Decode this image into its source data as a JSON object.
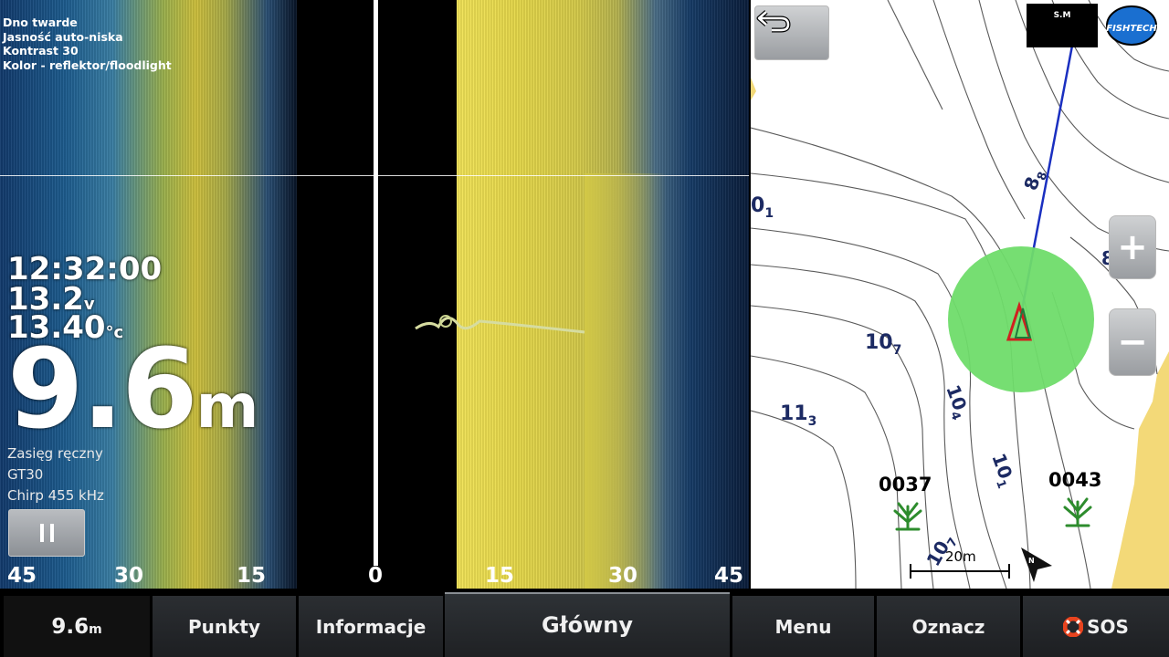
{
  "sonar": {
    "settings": [
      "Dno twarde",
      "Jasność auto-niska",
      "Kontrast 30",
      "Kolor - reflektor/floodlight"
    ],
    "time": "12:32:00",
    "voltage": "13.2",
    "voltage_unit": "v",
    "temperature": "13.40",
    "temperature_unit": "°c",
    "depth": "9.6",
    "depth_unit": "m",
    "range_mode": "Zasięg ręczny",
    "transducer": "GT30",
    "frequency": "Chirp 455 kHz",
    "scale": [
      "45",
      "30",
      "15",
      "0",
      "15",
      "30",
      "45"
    ]
  },
  "map": {
    "depth_labels": [
      {
        "main": "0",
        "sub": "1"
      },
      {
        "main": "8",
        "sub": "8"
      },
      {
        "main": "10",
        "sub": "7"
      },
      {
        "main": "11",
        "sub": "3"
      },
      {
        "main": "10",
        "sub": "4"
      },
      {
        "main": "10",
        "sub": "1"
      },
      {
        "main": "10",
        "sub": "7"
      },
      {
        "main": "8",
        "sub": "8"
      }
    ],
    "waypoint_1": "0037",
    "waypoint_2": "0043",
    "scale_label": "20m",
    "north_label": "N",
    "zoom_in": "+",
    "zoom_out": "−"
  },
  "logos": {
    "sm_text": "S.M",
    "fishtech_text": "FISHTECH"
  },
  "bottom_bar": {
    "depth_value": "9.6",
    "depth_unit": "m",
    "points": "Punkty",
    "info": "Informacje",
    "main": "Główny",
    "menu": "Menu",
    "mark": "Oznacz",
    "sos": "SOS"
  },
  "colors": {
    "route_line": "#1a2fc0",
    "position_circle": "#6fdc6a",
    "shoreline": "#f3d978",
    "contour": "#555555",
    "depth_label": "#1c2a63"
  }
}
